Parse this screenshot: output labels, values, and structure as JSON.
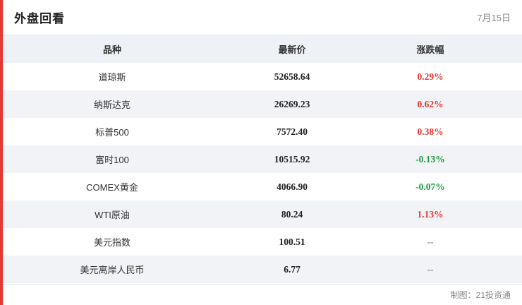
{
  "header": {
    "title": "外盘回看",
    "date": "7月15日"
  },
  "columns": {
    "name": "品种",
    "price": "最新价",
    "change": "涨跌幅"
  },
  "rows": [
    {
      "name": "道琼斯",
      "price": "52658.64",
      "change": "0.29%",
      "trend": "up"
    },
    {
      "name": "纳斯达克",
      "price": "26269.23",
      "change": "0.62%",
      "trend": "up"
    },
    {
      "name": "标普500",
      "price": "7572.40",
      "change": "0.38%",
      "trend": "up"
    },
    {
      "name": "富时100",
      "price": "10515.92",
      "change": "-0.13%",
      "trend": "down"
    },
    {
      "name": "COMEX黄金",
      "price": "4066.90",
      "change": "-0.07%",
      "trend": "down"
    },
    {
      "name": "WTI原油",
      "price": "80.24",
      "change": "1.13%",
      "trend": "up"
    },
    {
      "name": "美元指数",
      "price": "100.51",
      "change": "--",
      "trend": "flat"
    },
    {
      "name": "美元离岸人民币",
      "price": "6.77",
      "change": "--",
      "trend": "flat"
    }
  ],
  "footer": {
    "credit": "制图：21投资通"
  },
  "colors": {
    "accent": "#e53935",
    "up": "#e53935",
    "down": "#1a9a3c"
  }
}
